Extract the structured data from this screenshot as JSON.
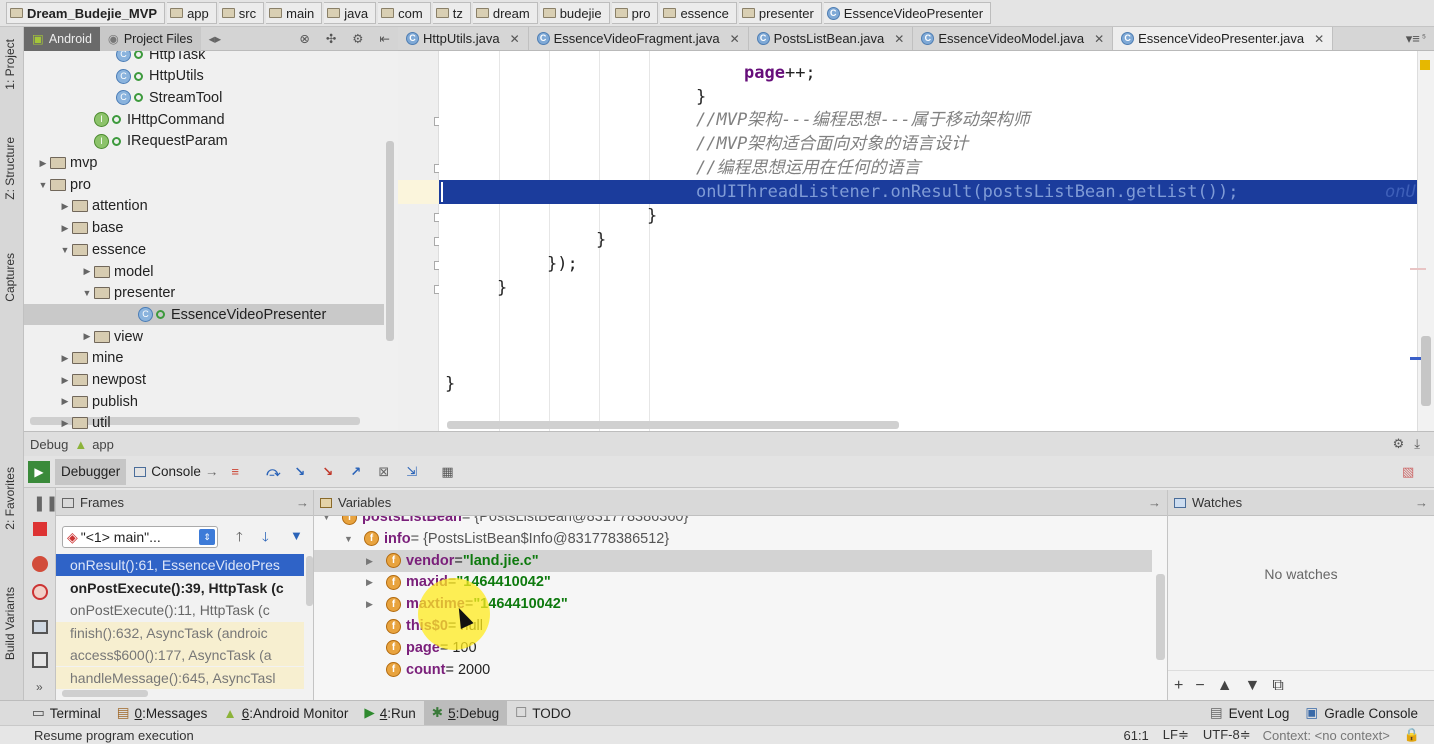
{
  "breadcrumbs": [
    "Dream_Budejie_MVP",
    "app",
    "src",
    "main",
    "java",
    "com",
    "tz",
    "dream",
    "budejie",
    "pro",
    "essence",
    "presenter",
    "EssenceVideoPresenter"
  ],
  "side_tabs": {
    "project": "1: Project",
    "structure": "Z: Structure",
    "captures": "Captures",
    "favorites": "2: Favorites",
    "build_variants": "Build Variants"
  },
  "project_tabs": {
    "android": "Android",
    "project_files": "Project Files"
  },
  "editor_tabs": [
    "HttpUtils.java",
    "EssenceVideoFragment.java",
    "PostsListBean.java",
    "EssenceVideoModel.java",
    "EssenceVideoPresenter.java"
  ],
  "editor_tabs_more": "⁵",
  "tree": [
    {
      "label": "HttpTask",
      "type": "class",
      "indent": 5
    },
    {
      "label": "HttpUtils",
      "type": "class",
      "indent": 5
    },
    {
      "label": "StreamTool",
      "type": "class",
      "indent": 5
    },
    {
      "label": "IHttpCommand",
      "type": "interface",
      "indent": 4
    },
    {
      "label": "IRequestParam",
      "type": "interface",
      "indent": 4
    },
    {
      "label": "mvp",
      "type": "folder",
      "indent": 2,
      "arrow": "▶"
    },
    {
      "label": "pro",
      "type": "folder",
      "indent": 2,
      "arrow": "▼"
    },
    {
      "label": "attention",
      "type": "folder",
      "indent": 3,
      "arrow": "▶"
    },
    {
      "label": "base",
      "type": "folder",
      "indent": 3,
      "arrow": "▶"
    },
    {
      "label": "essence",
      "type": "folder",
      "indent": 3,
      "arrow": "▼"
    },
    {
      "label": "model",
      "type": "folder",
      "indent": 4,
      "arrow": "▶"
    },
    {
      "label": "presenter",
      "type": "folder",
      "indent": 4,
      "arrow": "▼"
    },
    {
      "label": "EssenceVideoPresenter",
      "type": "class",
      "indent": 6,
      "selected": true
    },
    {
      "label": "view",
      "type": "folder",
      "indent": 4,
      "arrow": "▶"
    },
    {
      "label": "mine",
      "type": "folder",
      "indent": 3,
      "arrow": "▶"
    },
    {
      "label": "newpost",
      "type": "folder",
      "indent": 3,
      "arrow": "▶"
    },
    {
      "label": "publish",
      "type": "folder",
      "indent": 3,
      "arrow": "▶"
    },
    {
      "label": "util",
      "type": "folder",
      "indent": 3,
      "arrow": "▶"
    }
  ],
  "code": {
    "l1_page": "page",
    "l1_rest": "++;",
    "l2": "}",
    "c1": "//MVP架构---编程思想---属于移动架构师",
    "c2": "//MVP架构适合面向对象的语言设计",
    "c3": "//编程思想运用在任何的语言",
    "highlight": "onUIThreadListener.onResult(postsListBean.getList());",
    "highlight_tail": "onU",
    "l6": "}",
    "l7": "}",
    "l8": "});",
    "l9": "}",
    "l10": "}"
  },
  "debug": {
    "label": "Debug",
    "config": "app",
    "tabs": {
      "debugger": "Debugger",
      "console": "Console"
    },
    "frames_title": "Frames",
    "thread": "\"<1> main\"...",
    "frames": [
      "onResult():61, EssenceVideoPres",
      "onPostExecute():39, HttpTask (c",
      "onPostExecute():11, HttpTask (c",
      "finish():632, AsyncTask (androic",
      "access$600():177, AsyncTask (a",
      "handleMessage():645, AsyncTasl"
    ],
    "variables_title": "Variables",
    "variables": [
      {
        "name": "postsListBean",
        "value": " = {PostsListBean@831778386360}",
        "indent": 0,
        "arrow": "▼"
      },
      {
        "name": "info",
        "value": " = {PostsListBean$Info@831778386512}",
        "indent": 1,
        "arrow": "▼"
      },
      {
        "name": "vendor",
        "value": "\"land.jie.c\"",
        "indent": 2,
        "arrow": "▶",
        "string": true,
        "selected": true
      },
      {
        "name": "maxid",
        "value": "\"1464410042\"",
        "indent": 2,
        "arrow": "▶",
        "string": true
      },
      {
        "name": "maxtime",
        "value": "\"1464410042\"",
        "indent": 2,
        "arrow": "▶",
        "string": true
      },
      {
        "name": "this$0",
        "value": " = null",
        "indent": 2,
        "arrow": ""
      },
      {
        "name": "page",
        "value": " = 100",
        "indent": 2,
        "arrow": ""
      },
      {
        "name": "count",
        "value": " = 2000",
        "indent": 2,
        "arrow": ""
      }
    ],
    "watches_title": "Watches",
    "no_watches": "No watches"
  },
  "bottom_tabs": [
    {
      "label": "Terminal",
      "key": ""
    },
    {
      "label": "Messages",
      "key": "0"
    },
    {
      "label": "Android Monitor",
      "key": "6"
    },
    {
      "label": "Run",
      "key": "4"
    },
    {
      "label": "Debug",
      "key": "5",
      "active": true
    },
    {
      "label": "TODO",
      "key": ""
    }
  ],
  "bottom_right": {
    "event_log": "Event Log",
    "gradle_console": "Gradle Console"
  },
  "status": {
    "message": "Resume program execution",
    "position": "61:1",
    "line_sep": "LF≑",
    "encoding": "UTF-8≑",
    "context": "Context: <no context>"
  }
}
